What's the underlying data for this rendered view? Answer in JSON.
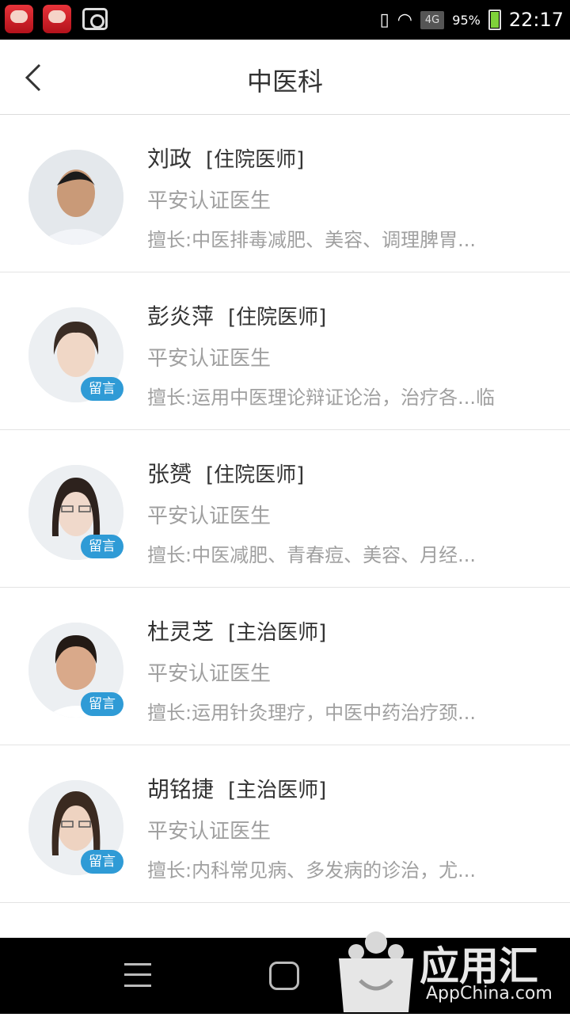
{
  "status_bar": {
    "battery_pct": "95%",
    "network": "4G",
    "time": "22:17",
    "icons": [
      "app-icon",
      "app-icon",
      "screenshot-icon",
      "vibrate-icon",
      "wifi-icon",
      "signal-icon",
      "battery-icon"
    ]
  },
  "header": {
    "title": "中医科",
    "back_icon": "chevron-left-icon"
  },
  "doctors": [
    {
      "name": "刘政",
      "title": "[住院医师]",
      "cert": "平安认证医生",
      "specialty": "擅长:中医排毒减肥、美容、调理脾胃...",
      "badge": ""
    },
    {
      "name": "彭炎萍",
      "title": "[住院医师]",
      "cert": "平安认证医生",
      "specialty": "擅长:运用中医理论辩证论治，治疗各...临",
      "badge": "留言"
    },
    {
      "name": "张赟",
      "title": "[住院医师]",
      "cert": "平安认证医生",
      "specialty": "擅长:中医减肥、青春痘、美容、月经...",
      "badge": "留言"
    },
    {
      "name": "杜灵芝",
      "title": "[主治医师]",
      "cert": "平安认证医生",
      "specialty": "擅长:运用针灸理疗，中医中药治疗颈...",
      "badge": "留言"
    },
    {
      "name": "胡铭捷",
      "title": "[主治医师]",
      "cert": "平安认证医生",
      "specialty": "擅长:内科常见病、多发病的诊治，尤...",
      "badge": "留言"
    }
  ],
  "watermark": {
    "text": "应用汇",
    "sub": "AppChina.com"
  },
  "colors": {
    "badge": "#2f9bd6",
    "secondary_text": "#a0a0a0",
    "primary_text": "#333333"
  }
}
